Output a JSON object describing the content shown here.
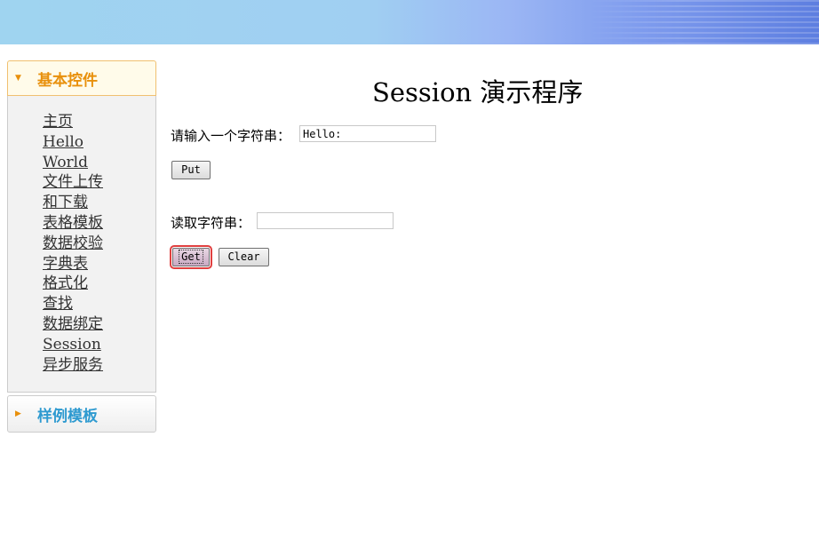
{
  "page": {
    "title": "Session 演示程序"
  },
  "sidebar": {
    "panes": [
      {
        "title": "基本控件",
        "expanded": true,
        "items": [
          "主页",
          "Hello",
          "World",
          "文件上传",
          "和下载",
          "表格模板",
          "数据校验",
          "字典表",
          "格式化",
          "查找",
          "数据绑定",
          "Session",
          "异步服务"
        ]
      },
      {
        "title": "样例模板",
        "expanded": false
      }
    ]
  },
  "form": {
    "input_label": "请输入一个字符串：",
    "input_value": "Hello:",
    "put_label": "Put",
    "read_label": "读取字符串：",
    "read_value": "",
    "get_label": "Get",
    "clear_label": "Clear"
  },
  "colors": {
    "accent_orange": "#e8900c",
    "accent_blue": "#2e9ad0",
    "focus_ring": "#e04040"
  }
}
